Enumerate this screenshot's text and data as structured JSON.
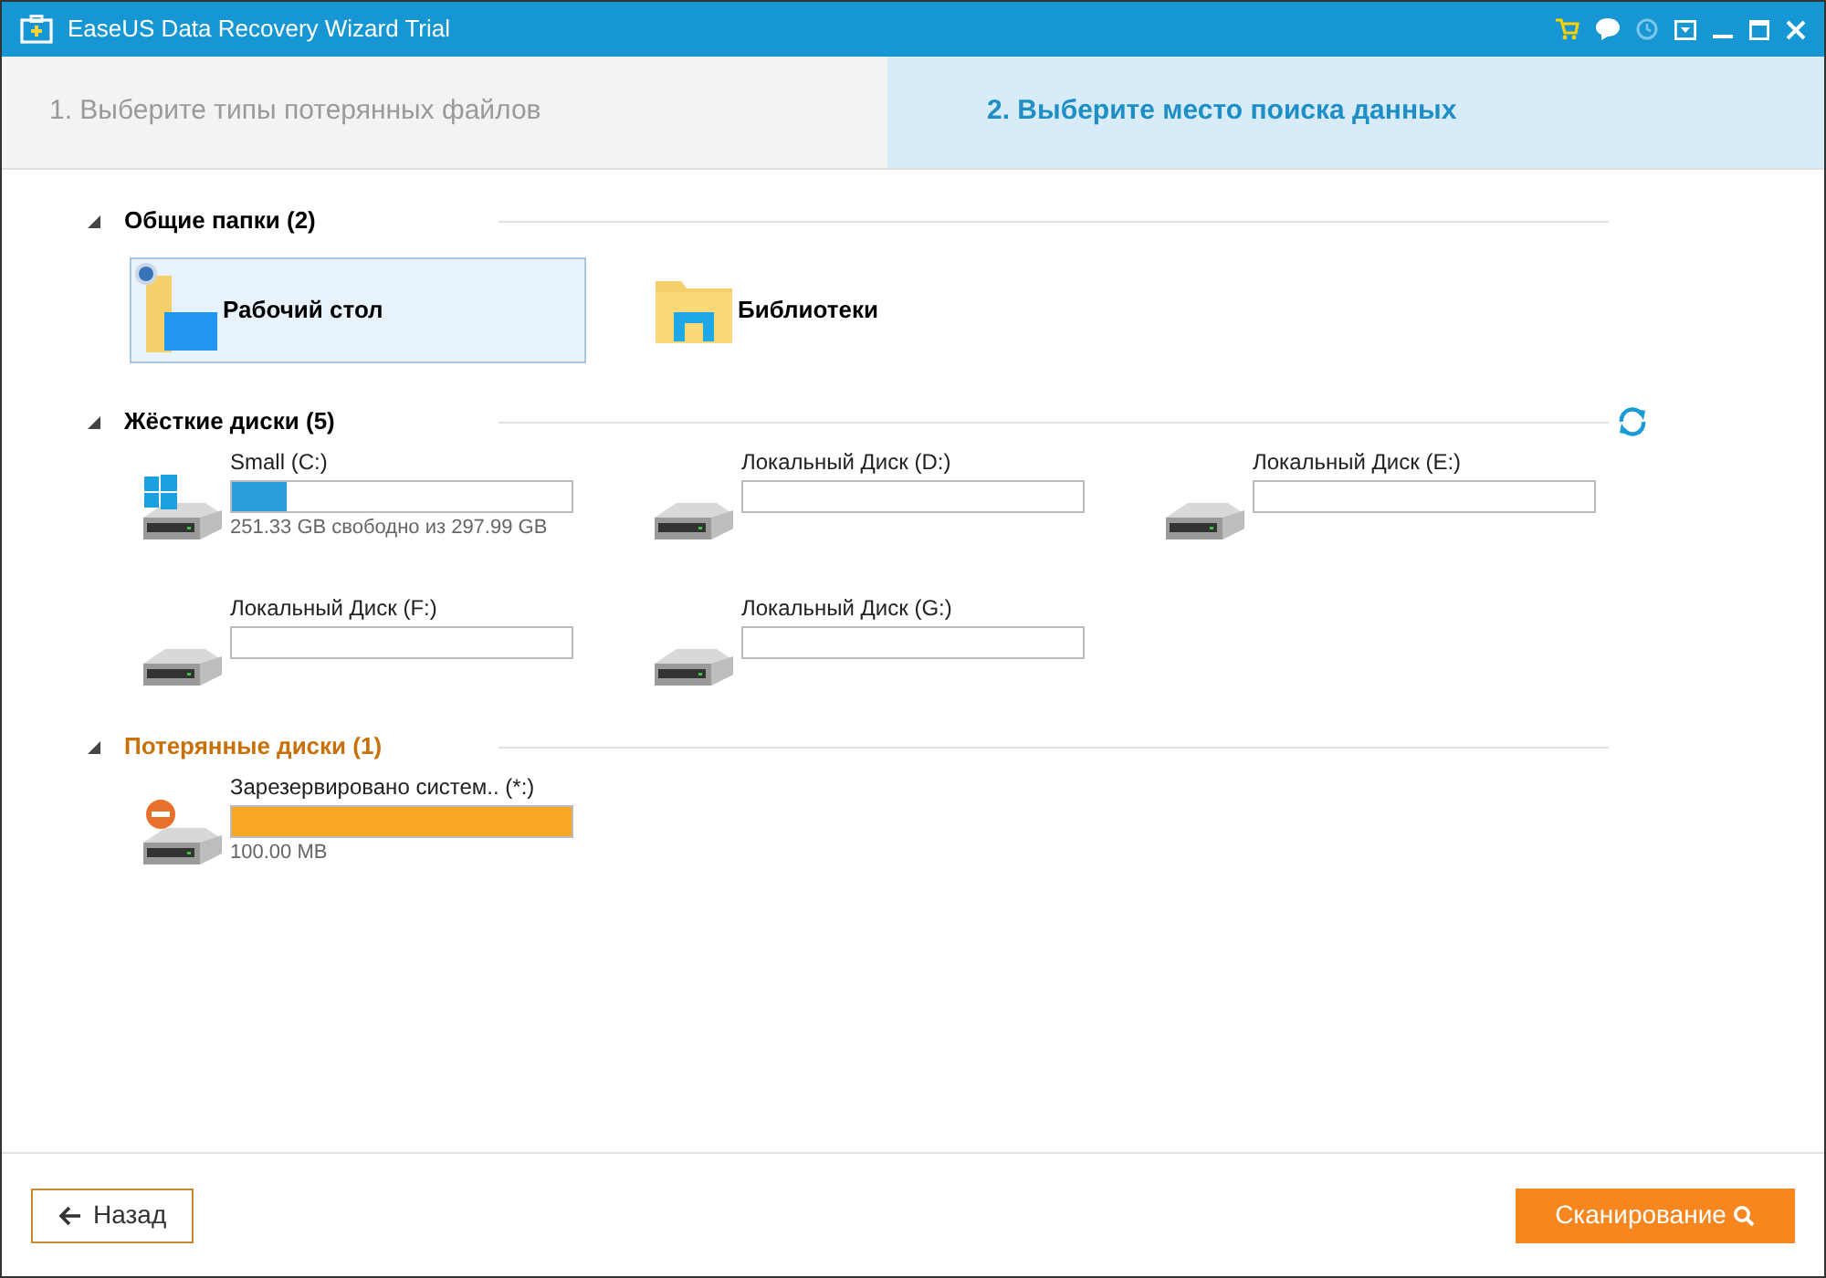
{
  "window": {
    "title": "EaseUS Data Recovery Wizard Trial"
  },
  "steps": [
    {
      "label": "1. Выберите типы потерянных файлов",
      "selected": false
    },
    {
      "label": "2. Выберите место поиска данных",
      "selected": true
    }
  ],
  "sections": [
    {
      "kind": "folders",
      "title": "Общие папки (2)",
      "expanded": true,
      "items": [
        {
          "kind": "desktop",
          "label": "Рабочий стол",
          "selected": true
        },
        {
          "kind": "library",
          "label": "Библиотеки",
          "selected": false
        }
      ]
    },
    {
      "kind": "disks",
      "title": "Жёсткие диски (5)",
      "expanded": true,
      "items": [
        {
          "kind": "system",
          "label": "Small (C:)",
          "level": 0.16,
          "info": "251.33 GB свободно из 297.99 GB"
        },
        {
          "kind": "local",
          "label": "Локальный Диск (D:)"
        },
        {
          "kind": "local",
          "label": "Локальный Диск (E:)"
        },
        {
          "kind": "local",
          "label": "Локальный Диск (F:)"
        },
        {
          "kind": "local",
          "label": "Локальный Диск (G:)"
        }
      ]
    },
    {
      "kind": "lost",
      "title": "Потерянные диски (1)",
      "expanded": true,
      "items": [
        {
          "kind": "lost",
          "label": "Зарезервировано систем.. (*:)",
          "level": 1,
          "info": "100.00 MB"
        }
      ]
    }
  ],
  "buttons": {
    "back": "Назад",
    "scan": "Сканирование"
  }
}
